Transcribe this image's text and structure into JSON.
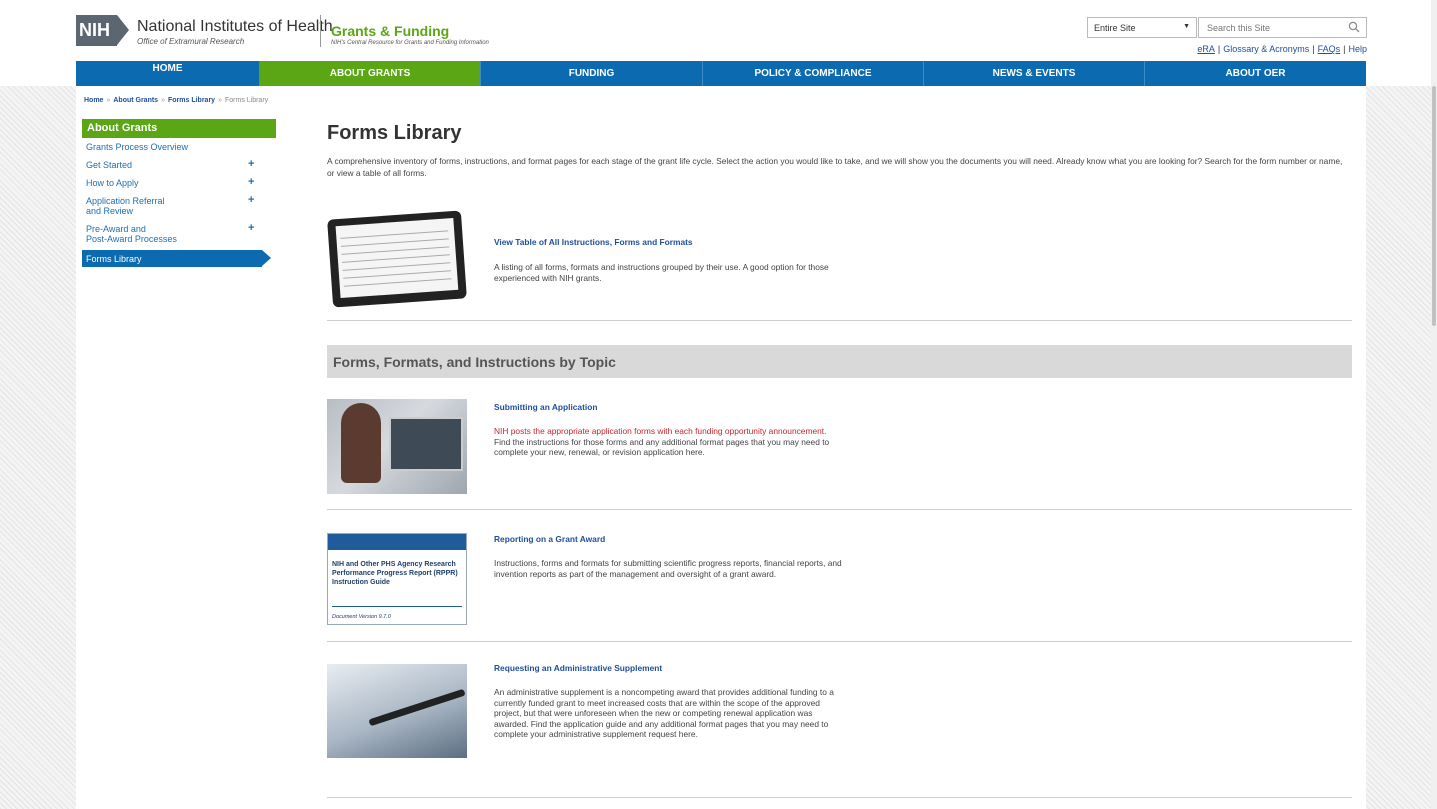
{
  "header": {
    "logo_mark": "NIH",
    "org_name": "National Institutes of Health",
    "org_sub": "Office of Extramural Research",
    "section_title": "Grants & Funding",
    "section_sub": "NIH's Central Resource for Grants and Funding Information",
    "search": {
      "scope_value": "Entire Site",
      "placeholder": "Search this Site"
    },
    "utility_links": [
      "eRA",
      "Glossary & Acronyms",
      "FAQs",
      "Help"
    ]
  },
  "nav": {
    "items": [
      "HOME",
      "ABOUT GRANTS",
      "FUNDING",
      "POLICY & COMPLIANCE",
      "NEWS & EVENTS",
      "ABOUT OER"
    ],
    "active": "ABOUT GRANTS"
  },
  "breadcrumb": [
    "Home",
    "About Grants",
    "Forms Library",
    "Forms Library"
  ],
  "breadcrumb_sep": "»",
  "sidebar": {
    "heading": "About Grants",
    "items": [
      {
        "label": "Grants Process Overview"
      },
      {
        "label": "Get Started",
        "expand": "+"
      },
      {
        "label": "How to Apply",
        "expand": "+"
      },
      {
        "label": "Application Referral",
        "label2": "and Review",
        "expand": "+"
      },
      {
        "label": "Pre-Award and",
        "label2": "Post-Award Processes",
        "expand": "+"
      },
      {
        "label": "Forms Library"
      }
    ]
  },
  "main": {
    "title": "Forms Library",
    "intro": "A comprehensive inventory of forms, instructions, and format pages for each stage of the grant life cycle. Select the action you would like to take, and we will show you the documents you will need. Already know what you are looking for? Search for the form number or name, or view a table of all forms.",
    "feature": {
      "title": "View Table of All Instructions, Forms and Formats",
      "desc": "A listing of all forms, formats and instructions grouped by their use. A good option for those experienced with NIH grants."
    },
    "topic_heading": "Forms, Formats, and Instructions by Topic",
    "topics": [
      {
        "title": "Submitting an Application",
        "desc_red": "NIH posts the appropriate application forms with each funding opportunity announcement.",
        "desc": " Find the instructions for those forms and any additional format pages that you may need to complete your new, renewal, or revision application here."
      },
      {
        "title": "Reporting on a Grant Award",
        "desc": "Instructions, forms and formats for submitting scientific progress reports, financial reports, and invention reports as part of the management and oversight of a grant award.",
        "thumb_title": "NIH and Other PHS Agency Research Performance Progress Report (RPPR) Instruction Guide",
        "thumb_version": "Document Version 9.7.0"
      },
      {
        "title": "Requesting an Administrative Supplement",
        "desc": "An administrative supplement is a noncompeting award that provides additional funding to a currently funded grant to meet increased costs that are within the scope of the approved project, but that were unforeseen when the new or competing renewal application was awarded. Find the application guide and any additional format pages that you may need to complete your administrative supplement request here."
      }
    ]
  },
  "colors": {
    "nav_blue": "#0c6ab0",
    "nih_green": "#5aa614",
    "link_blue": "#1f4e9a",
    "alert_red": "#c4262e"
  }
}
